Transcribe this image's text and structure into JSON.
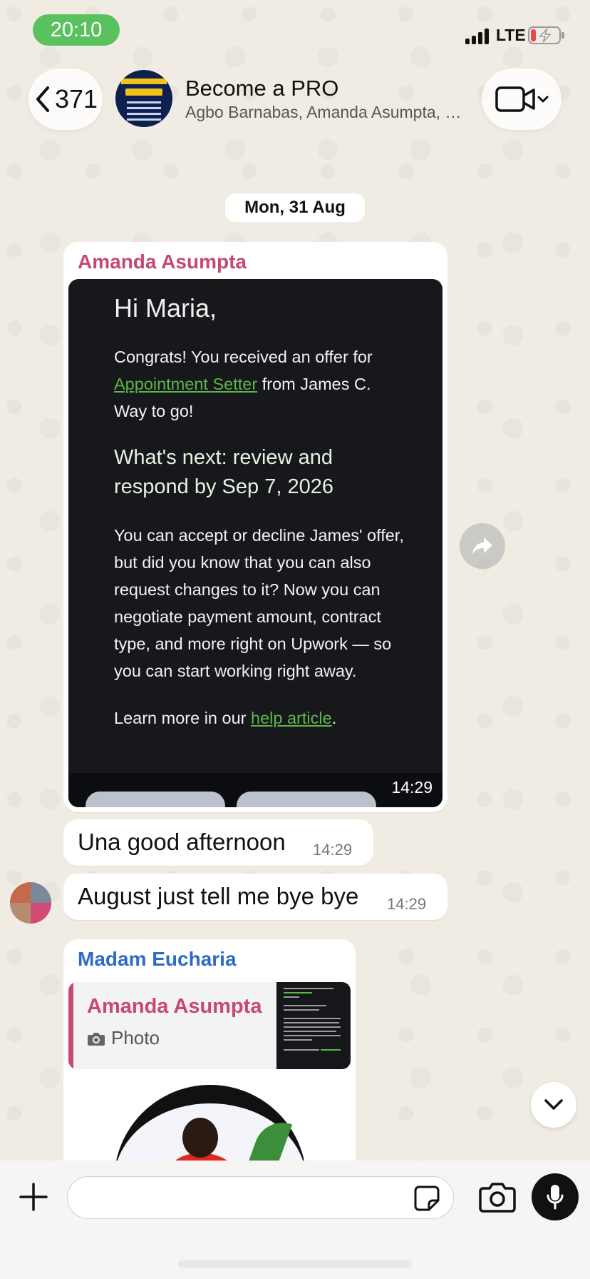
{
  "status_bar": {
    "time": "20:10",
    "network": "LTE"
  },
  "header": {
    "back_count": "371",
    "title": "Become a PRO",
    "subtitle": "Agbo Barnabas, Amanda Asumpta, Madam Eucharia"
  },
  "date_chip": "Mon, 31 Aug",
  "messages": [
    {
      "sender": "Amanda Asumpta",
      "sender_color": "#c8486f",
      "type": "image",
      "time": "14:29",
      "image_text": {
        "greeting": "Hi Maria,",
        "p1_pre": "Congrats! You received an offer for ",
        "p1_link": "Appointment Setter",
        "p1_post": " from James C. Way to go!",
        "heading": "What's next: review and respond by Sep 7, 2026",
        "p2": "You can accept or decline James' offer, but did you know that you can also request changes to it? Now you can negotiate payment amount, contract type, and more right on Upwork — so you can start working right away.",
        "p3_pre": "Learn more in our ",
        "p3_link": "help article",
        "p3_post": "."
      }
    },
    {
      "type": "text",
      "text": "Una good afternoon",
      "time": "14:29"
    },
    {
      "type": "text",
      "text": "August just tell me bye bye",
      "time": "14:29"
    },
    {
      "sender": "Madam Eucharia",
      "sender_color": "#2e6bc4",
      "type": "reply",
      "quoted_sender": "Amanda Asumpta",
      "quoted_type": "Photo"
    }
  ],
  "input": {
    "placeholder": ""
  },
  "icons": {
    "back": "chevron-left-icon",
    "video": "video-camera-icon",
    "forward": "forward-icon",
    "scroll": "chevron-down-icon",
    "plus": "plus-icon",
    "sticker": "sticker-icon",
    "camera": "camera-icon",
    "mic": "microphone-icon"
  },
  "colors": {
    "time_pill": "#5ac15f",
    "link_green": "#5cb54a"
  }
}
